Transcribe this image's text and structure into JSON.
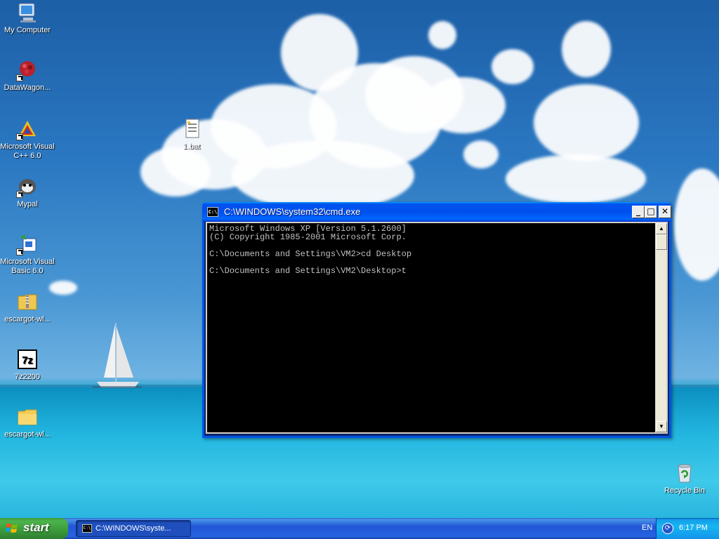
{
  "desktop": {
    "icons": [
      {
        "label": "My Computer",
        "icon": "my-computer-icon"
      },
      {
        "label": "DataWagon...",
        "icon": "datawagon-icon"
      },
      {
        "label": "Microsoft Visual\nC++ 6.0",
        "icon": "visual-cpp-icon"
      },
      {
        "label": "Mypal",
        "icon": "mypal-icon"
      },
      {
        "label": "Microsoft Visual\nBasic 6.0",
        "icon": "visual-basic-icon"
      },
      {
        "label": "escargot-wl...",
        "icon": "zip-folder-icon"
      },
      {
        "label": "7z2200",
        "icon": "7zip-icon"
      },
      {
        "label": "escargot-wl...",
        "icon": "folder-icon"
      },
      {
        "label": "1.bat",
        "icon": "batch-file-icon"
      },
      {
        "label": "Recycle Bin",
        "icon": "recycle-bin-icon"
      }
    ]
  },
  "cmd_window": {
    "title": "C:\\WINDOWS\\system32\\cmd.exe",
    "icon_text": "C:\\",
    "minimize": "_",
    "maximize": "□",
    "close": "✕",
    "console_lines": "Microsoft Windows XP [Version 5.1.2600]\n(C) Copyright 1985-2001 Microsoft Corp.\n\nC:\\Documents and Settings\\VM2>cd Desktop\n\nC:\\Documents and Settings\\VM2\\Desktop>t",
    "scroll_up": "▲",
    "scroll_down": "▼"
  },
  "taskbar": {
    "start_label": "start",
    "task_label": "C:\\WINDOWS\\syste...",
    "task_icon_text": "C:\\",
    "language": "EN",
    "clock": "6:17 PM",
    "tray_icon_text": "⟳"
  },
  "colors": {
    "titlebar": "#0053ee",
    "taskbar": "#2457d4",
    "start_button": "#3b9a3b",
    "console_bg": "#000000",
    "console_fg": "#c0c0c0"
  }
}
